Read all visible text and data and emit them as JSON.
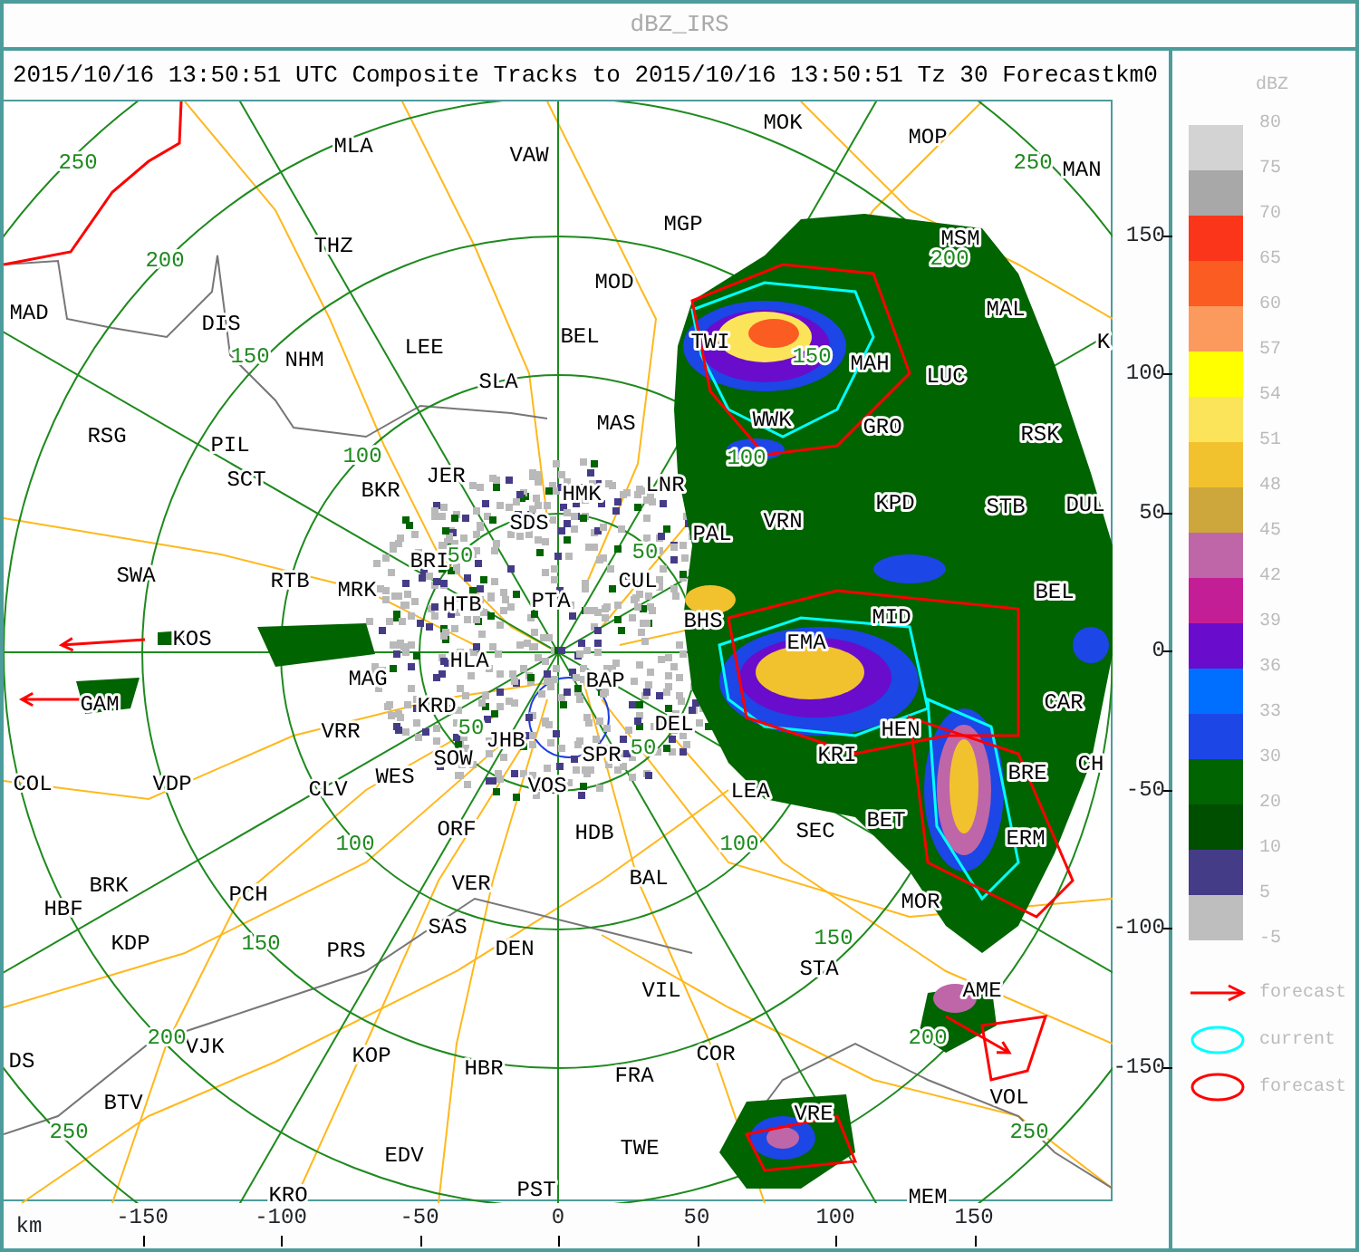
{
  "window": {
    "title": "dBZ_IRS"
  },
  "header": {
    "subtitle": "2015/10/16 13:50:51 UTC Composite Tracks to 2015/10/16 13:50:51 Tz 30 Forecast",
    "unit": "km",
    "value": "0"
  },
  "map": {
    "stations": [
      "MOK",
      "MOP",
      "MAN",
      "MLA",
      "VAW",
      "THZ",
      "MGP",
      "MSM",
      "MOD",
      "MAD",
      "DIS",
      "NHM",
      "LEE",
      "BEL",
      "TWI",
      "MAL",
      "MAH",
      "LUC",
      "K",
      "SLA",
      "RSG",
      "PIL",
      "MAS",
      "WWK",
      "GRO",
      "RSK",
      "SCT",
      "BKR",
      "JER",
      "HMK",
      "LNR",
      "SDS",
      "KPD",
      "STB",
      "DUL",
      "VRN",
      "PAL",
      "SWA",
      "RTB",
      "MRK",
      "BRI",
      "HTB",
      "PTA",
      "CUL",
      "MID",
      "BEL",
      "KOS",
      "HLA",
      "BHS",
      "EMA",
      "MAG",
      "KRD",
      "BAP",
      "GAM",
      "CAR",
      "VRR",
      "JHB",
      "DEL",
      "HEN",
      "SOW",
      "SPR",
      "KRI",
      "CH",
      "BRE",
      "COL",
      "VDP",
      "WES",
      "CLV",
      "VOS",
      "LEA",
      "ORF",
      "HDB",
      "SEC",
      "BET",
      "ERM",
      "BRK",
      "VER",
      "BAL",
      "HBF",
      "PCH",
      "MOR",
      "SAS",
      "KDP",
      "PRS",
      "DEN",
      "STA",
      "AME",
      "VIL",
      "VJK",
      "KOP",
      "HBR",
      "FRA",
      "COR",
      "DS",
      "BTV",
      "VOL",
      "VRE",
      "EDV",
      "TWE",
      "KRO",
      "PST",
      "MEM"
    ],
    "range_labels": [
      "250",
      "200",
      "150",
      "100",
      "50",
      "50",
      "100",
      "150",
      "200",
      "250",
      "50",
      "50",
      "100",
      "100",
      "150",
      "150",
      "200",
      "200",
      "250",
      "250"
    ],
    "y_axis": [
      "150",
      "100",
      "50",
      "0",
      "-50",
      "-100",
      "-150"
    ],
    "x_axis": {
      "unit": "km",
      "ticks": [
        "-150",
        "-100",
        "-50",
        "0",
        "50",
        "100",
        "150"
      ]
    }
  },
  "legend": {
    "title": "dBZ",
    "levels": [
      {
        "label": "80",
        "color": "#d3d3d3"
      },
      {
        "label": "75",
        "color": "#a8a8a8"
      },
      {
        "label": "70",
        "color": "#fb3519"
      },
      {
        "label": "65",
        "color": "#fb5c22"
      },
      {
        "label": "60",
        "color": "#fb9a5c"
      },
      {
        "label": "57",
        "color": "#ffff00"
      },
      {
        "label": "54",
        "color": "#fce45a"
      },
      {
        "label": "51",
        "color": "#f2c22e"
      },
      {
        "label": "48",
        "color": "#cda63c"
      },
      {
        "label": "45",
        "color": "#be66a8"
      },
      {
        "label": "42",
        "color": "#c41e96"
      },
      {
        "label": "39",
        "color": "#6a0ccc"
      },
      {
        "label": "36",
        "color": "#006eff"
      },
      {
        "label": "33",
        "color": "#1c46e6"
      },
      {
        "label": "30",
        "color": "#006400"
      },
      {
        "label": "20",
        "color": "#004e00"
      },
      {
        "label": "10",
        "color": "#453c88"
      },
      {
        "label": "5",
        "color": "#bebebe"
      }
    ],
    "bottom_label": "-5",
    "keys": [
      {
        "kind": "arrow",
        "label": "forecast",
        "color": "#ff0000"
      },
      {
        "kind": "ellipse",
        "label": "current",
        "color": "#00ffff"
      },
      {
        "kind": "ellipse",
        "label": "forecast",
        "color": "#ff0000"
      }
    ]
  }
}
